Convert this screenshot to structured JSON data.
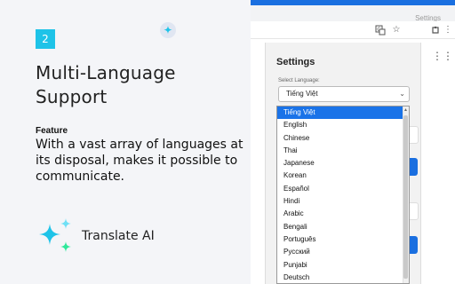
{
  "promo": {
    "step_number": "2",
    "title": "Multi-Language Support",
    "feature_label": "Feature",
    "feature_text": "With a vast array of languages at its disposal, makes it possible to communicate.",
    "brand_name": "Translate AI"
  },
  "browser": {
    "tab_title": "Settings",
    "toolbar_icons": [
      "translate-icon",
      "star-icon",
      "extension-active-icon",
      "refresh-icon",
      "menu-icon"
    ]
  },
  "popup": {
    "title": "Settings",
    "select_label": "Select Language:",
    "selected_language": "Tiếng Việt"
  },
  "dropdown": {
    "options": [
      "Tiếng Việt",
      "English",
      "Chinese",
      "Thai",
      "Japanese",
      "Korean",
      "Español",
      "Hindi",
      "Arabic",
      "Bengali",
      "Português",
      "Русский",
      "Punjabi",
      "Deutsch"
    ],
    "selected_index": 0
  },
  "colors": {
    "accent": "#1ec3e8",
    "primary_blue": "#1a73e8",
    "sparkle_green": "#2ee89a"
  }
}
